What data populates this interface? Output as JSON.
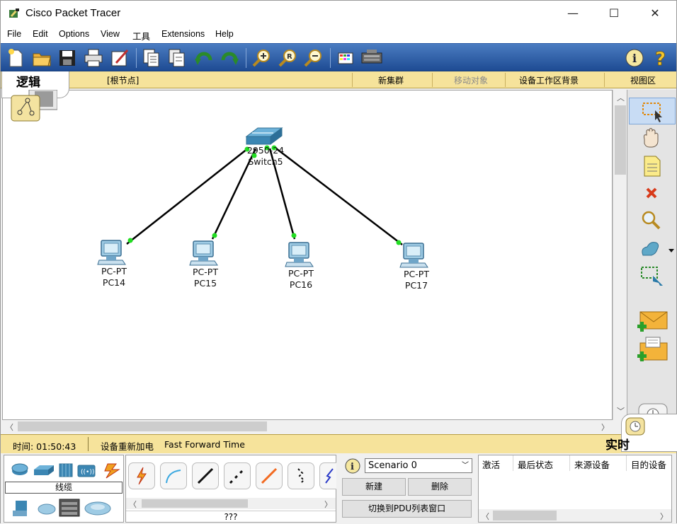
{
  "window": {
    "title": "Cisco Packet Tracer",
    "controls": {
      "minimize": "—",
      "maximize": "☐",
      "close": "✕"
    }
  },
  "menu": [
    "File",
    "Edit",
    "Options",
    "View",
    "工具",
    "Extensions",
    "Help"
  ],
  "toolbar": {
    "icons": [
      "new-file-icon",
      "open-folder-icon",
      "save-icon",
      "print-icon",
      "activity-wizard-icon",
      "copy-icon",
      "paste-icon",
      "undo-icon",
      "redo-icon",
      "zoom-in-icon",
      "zoom-reset-icon",
      "zoom-out-icon",
      "palette-icon",
      "custom-device-icon",
      "info-icon",
      "help-icon"
    ]
  },
  "logical_bar": {
    "tab_label": "逻辑",
    "root_node": "[根节点]",
    "new_cluster": "新集群",
    "move_object": "移动对象",
    "workspace_bg": "设备工作区背景",
    "viewport": "视图区"
  },
  "topology": {
    "switch": {
      "model": "2950-24",
      "name": "Switch5"
    },
    "pcs": [
      {
        "type": "PC-PT",
        "name": "PC14"
      },
      {
        "type": "PC-PT",
        "name": "PC15"
      },
      {
        "type": "PC-PT",
        "name": "PC16"
      },
      {
        "type": "PC-PT",
        "name": "PC17"
      }
    ],
    "link_color": "#000000",
    "port_color": "#22dd22"
  },
  "right_tools": [
    "select-icon",
    "move-hand-icon",
    "note-icon",
    "delete-icon",
    "inspect-icon",
    "draw-shape-icon",
    "resize-icon",
    "add-simple-pdu-icon",
    "add-complex-pdu-icon"
  ],
  "status": {
    "time_label": "时间: 01:50:43",
    "power_cycle": "设备重新加电",
    "fast_forward": "Fast Forward Time",
    "realtime_label": "实时"
  },
  "device_panel": {
    "category_label": "线缆",
    "cable_footer": "???"
  },
  "scenario": {
    "selected": "Scenario 0",
    "new_button": "新建",
    "delete_button": "删除",
    "toggle_button": "切换到PDU列表窗口"
  },
  "pdu_table": {
    "columns": [
      "激活",
      "最后状态",
      "来源设备",
      "目的设备"
    ]
  },
  "colors": {
    "toolbar_blue": "#2f5fa8",
    "bar_yellow": "#f6e39b"
  }
}
